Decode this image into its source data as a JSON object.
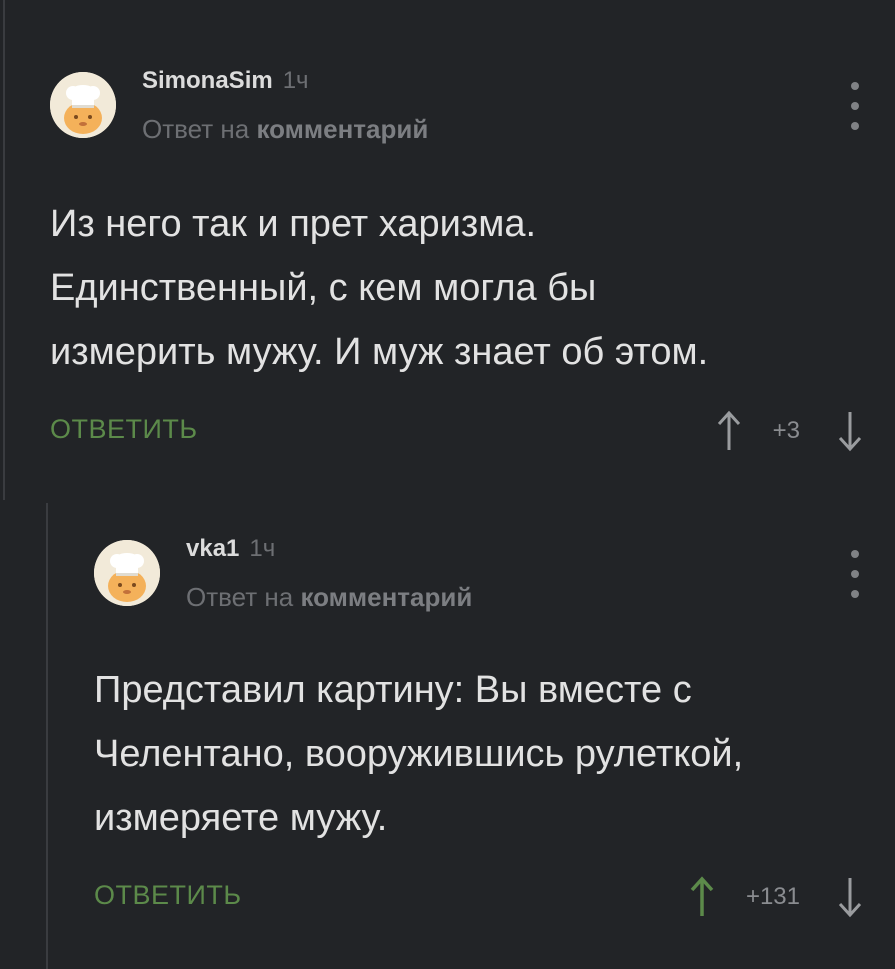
{
  "comments": [
    {
      "username": "SimonaSim",
      "time": "1ч",
      "reply_prefix": "Ответ на ",
      "reply_link": "комментарий",
      "text_lines": [
        "Из него так и прет харизма.",
        "Единственный, с кем могла бы",
        "измерить мужу. И муж знает об этом."
      ],
      "reply_label": "ОТВЕТИТЬ",
      "score": "+3",
      "upvoted": false
    },
    {
      "username": "vka1",
      "time": "1ч",
      "reply_prefix": "Ответ на ",
      "reply_link": "комментарий",
      "text_lines": [
        "Представил картину: Вы вместе с",
        "Челентано, вооружившись рулеткой,",
        "измеряете мужу."
      ],
      "reply_label": "ОТВЕТИТЬ",
      "score": "+131",
      "upvoted": true
    }
  ],
  "colors": {
    "background": "#222427",
    "accent_green": "#5c8a4a",
    "muted": "#6d6f73",
    "text": "#e2e2e2"
  },
  "icons": {
    "avatar": "chef-avatar-icon",
    "menu": "more-vertical-icon",
    "upvote": "arrow-up-icon",
    "downvote": "arrow-down-icon"
  }
}
